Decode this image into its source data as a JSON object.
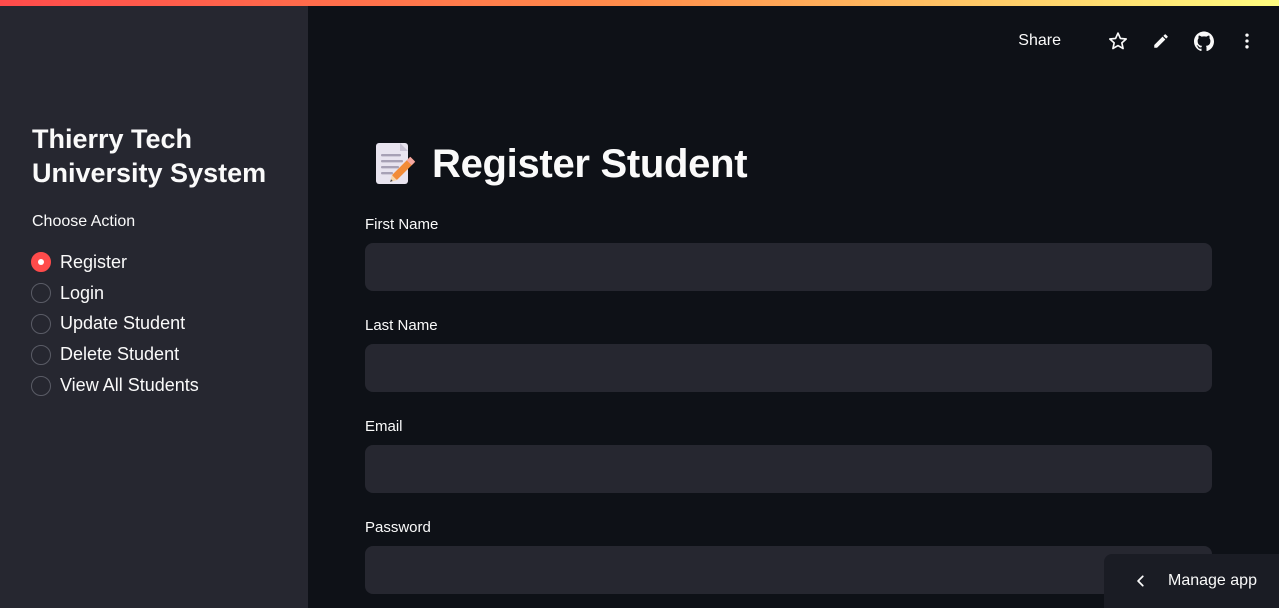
{
  "sidebar": {
    "title": "Thierry Tech University System",
    "choose_label": "Choose Action",
    "options": [
      {
        "label": "Register",
        "selected": true
      },
      {
        "label": "Login",
        "selected": false
      },
      {
        "label": "Update Student",
        "selected": false
      },
      {
        "label": "Delete Student",
        "selected": false
      },
      {
        "label": "View All Students",
        "selected": false
      }
    ]
  },
  "header": {
    "share_label": "Share",
    "icons": [
      "star-icon",
      "pencil-icon",
      "github-icon",
      "more-vertical-icon"
    ]
  },
  "main": {
    "title_emoji": "memo-icon",
    "title": "Register Student",
    "fields": [
      {
        "label": "First Name",
        "value": "",
        "placeholder": ""
      },
      {
        "label": "Last Name",
        "value": "",
        "placeholder": ""
      },
      {
        "label": "Email",
        "value": "",
        "placeholder": ""
      },
      {
        "label": "Password",
        "value": "",
        "placeholder": ""
      }
    ]
  },
  "manage_app": {
    "label": "Manage app"
  },
  "colors": {
    "accent": "#ff4b4b",
    "background": "#0e1117",
    "sidebar": "#262730",
    "input": "#262730"
  }
}
